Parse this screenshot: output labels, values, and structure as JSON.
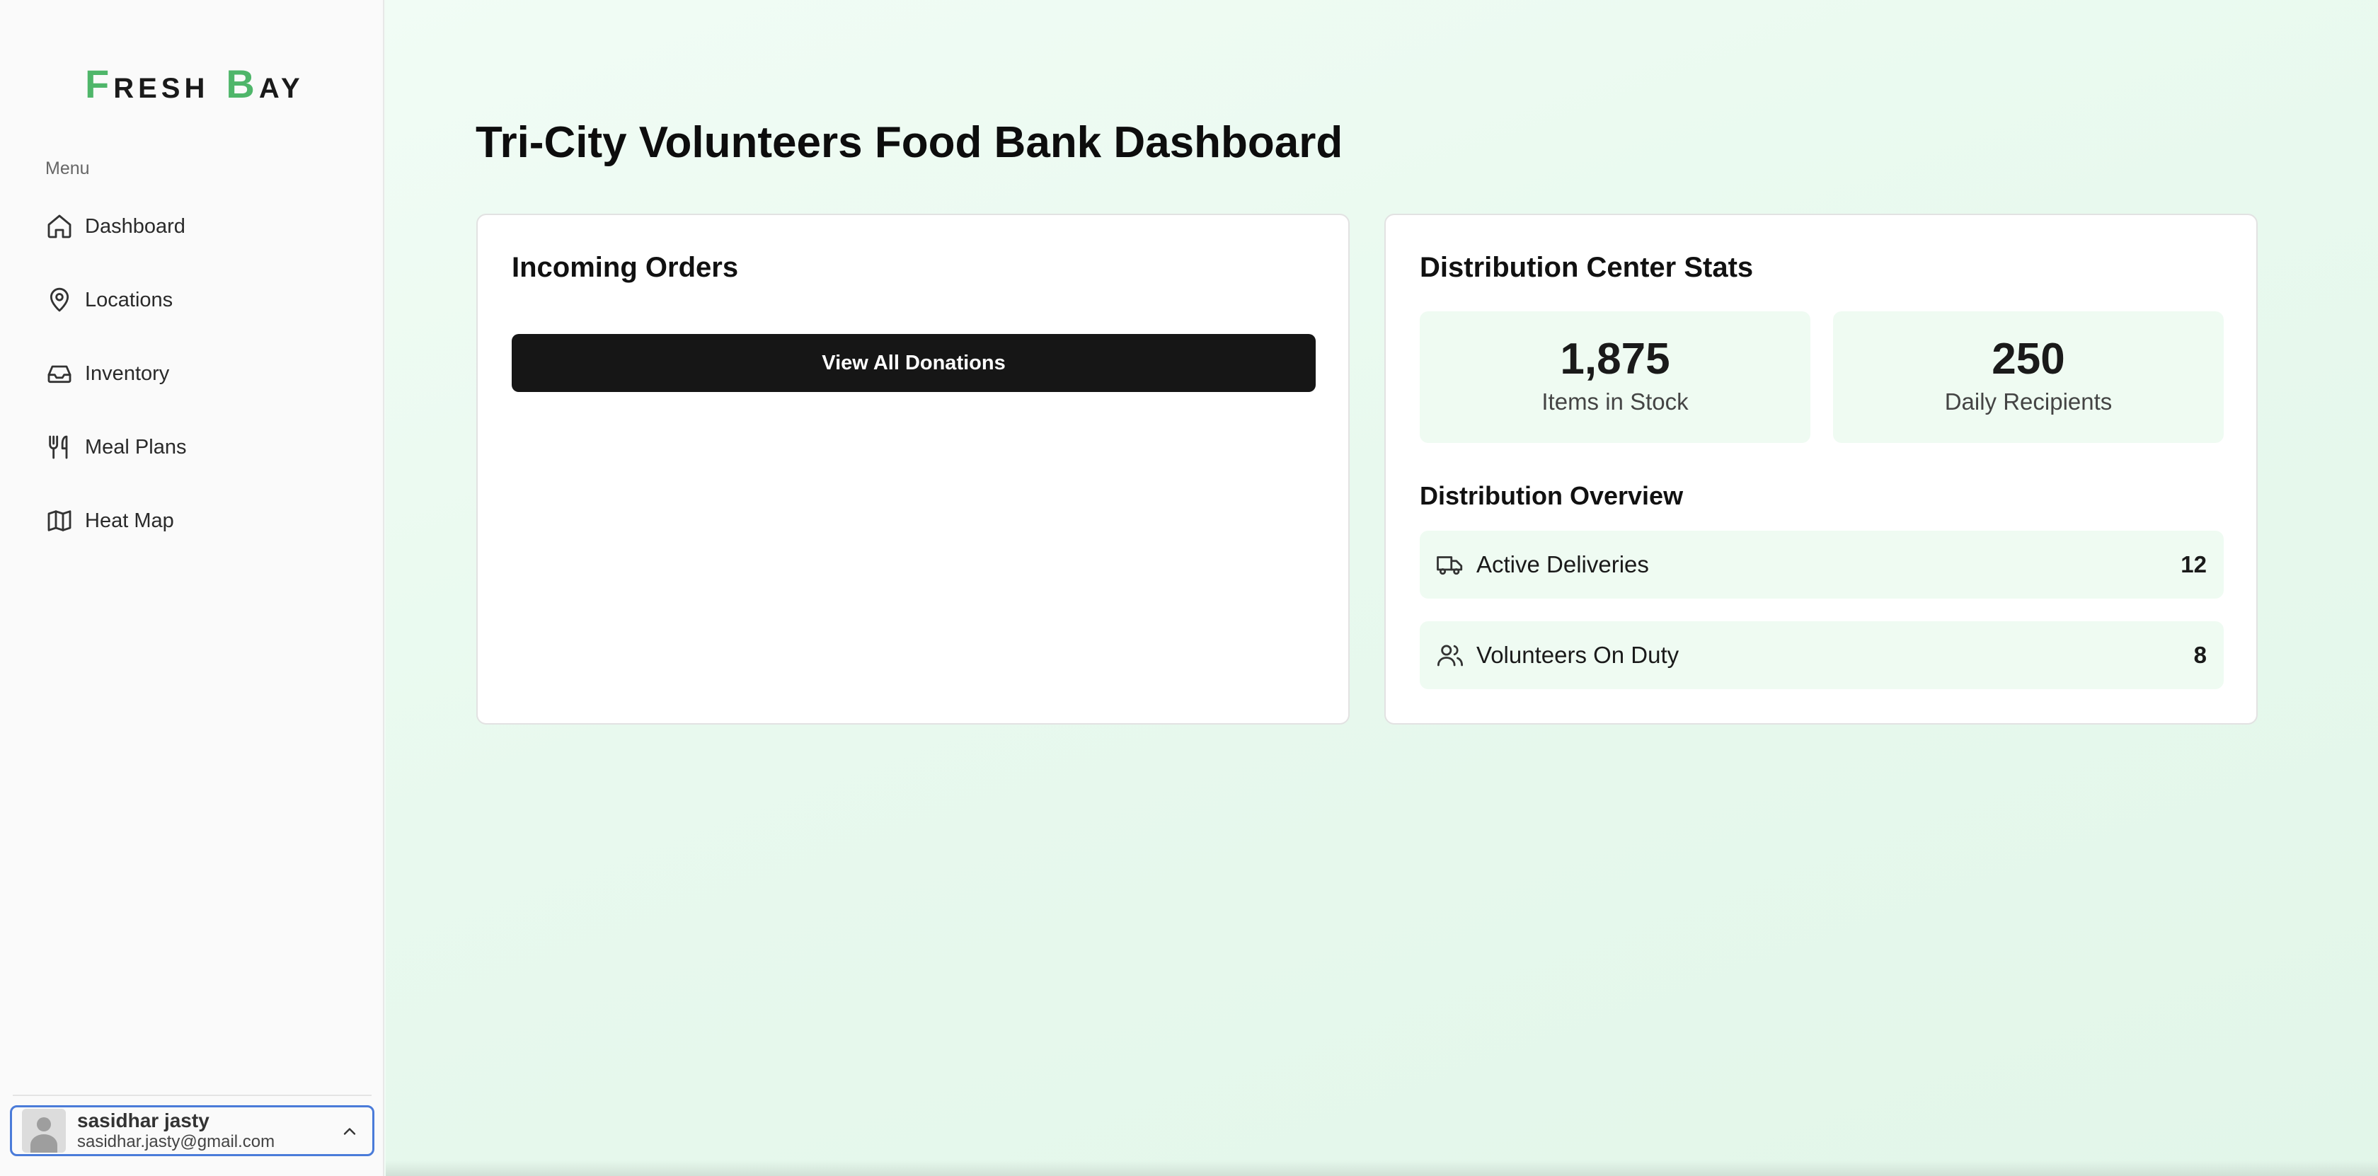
{
  "brand": {
    "first_initial": "F",
    "first_rest": "RESH",
    "second_initial": "B",
    "second_rest": "AY",
    "accent_color": "#4fb66a"
  },
  "sidebar": {
    "menu_label": "Menu",
    "items": [
      {
        "label": "Dashboard",
        "icon": "home-icon"
      },
      {
        "label": "Locations",
        "icon": "map-pin-icon"
      },
      {
        "label": "Inventory",
        "icon": "inbox-icon"
      },
      {
        "label": "Meal Plans",
        "icon": "utensils-icon"
      },
      {
        "label": "Heat Map",
        "icon": "map-icon"
      }
    ],
    "user": {
      "name": "sasidhar jasty",
      "email": "sasidhar.jasty@gmail.com"
    }
  },
  "main": {
    "title": "Tri-City Volunteers Food Bank Dashboard",
    "orders_card": {
      "title": "Incoming Orders",
      "button_label": "View All Donations"
    },
    "stats_card": {
      "title": "Distribution Center Stats",
      "stats": [
        {
          "value": "1,875",
          "label": "Items in Stock"
        },
        {
          "value": "250",
          "label": "Daily Recipients"
        }
      ],
      "overview_title": "Distribution Overview",
      "overview": [
        {
          "label": "Active Deliveries",
          "value": "12",
          "icon": "truck-icon"
        },
        {
          "label": "Volunteers On Duty",
          "value": "8",
          "icon": "users-icon"
        }
      ]
    }
  }
}
